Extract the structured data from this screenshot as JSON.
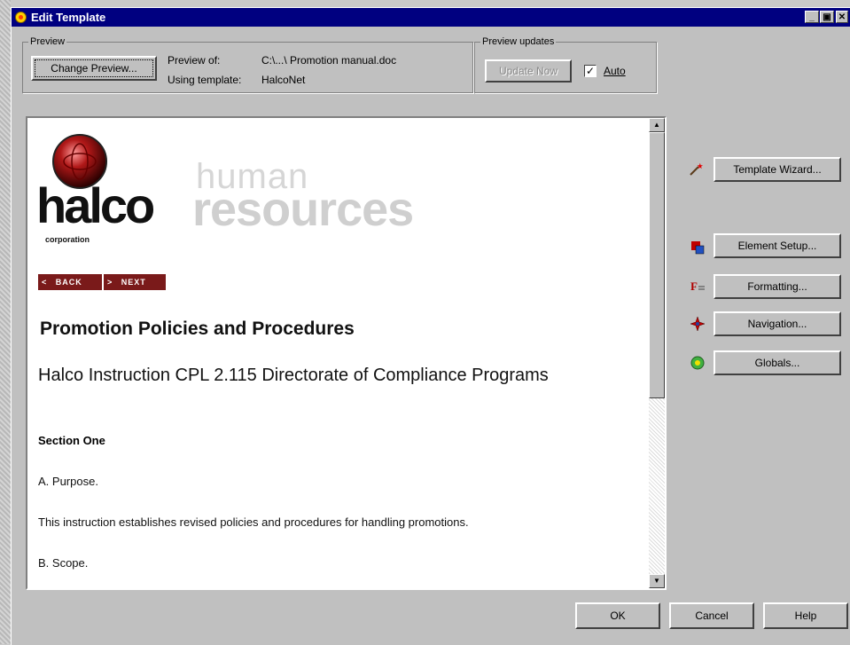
{
  "window": {
    "title": "Edit Template",
    "controls": {
      "minimize": "_",
      "maximize": "▣",
      "close": "✕"
    }
  },
  "preview_group": {
    "legend": "Preview",
    "change_button": "Change Preview...",
    "preview_of_label": "Preview of:",
    "preview_of_value": "C:\\...\\ Promotion manual.doc",
    "using_template_label": "Using template:",
    "using_template_value": "HalcoNet"
  },
  "updates_group": {
    "legend": "Preview updates",
    "update_button": "Update Now",
    "auto_label": "Auto",
    "auto_checked": true
  },
  "document": {
    "logo": {
      "word": "halco",
      "subword": "corporation",
      "tagline_top": "human",
      "tagline_bottom": "resources",
      "brand_color": "#8b1a1a"
    },
    "nav": {
      "back": "BACK",
      "next": "NEXT"
    },
    "heading": "Promotion Policies and Procedures",
    "subheading": "Halco Instruction CPL 2.115 Directorate of Compliance Programs",
    "section": "Section One",
    "purpose": "A. Purpose.",
    "paragraph": "This instruction establishes revised policies and procedures for handling promotions.",
    "scope": "B. Scope."
  },
  "side_buttons": [
    {
      "label": "Template Wizard...",
      "icon": "magic-wand-icon"
    },
    {
      "label": "Element Setup...",
      "icon": "element-setup-icon"
    },
    {
      "label": "Formatting...",
      "icon": "formatting-icon"
    },
    {
      "label": "Navigation...",
      "icon": "navigation-compass-icon"
    },
    {
      "label": "Globals...",
      "icon": "globals-icon"
    }
  ],
  "footer": {
    "ok": "OK",
    "cancel": "Cancel",
    "help": "Help"
  }
}
